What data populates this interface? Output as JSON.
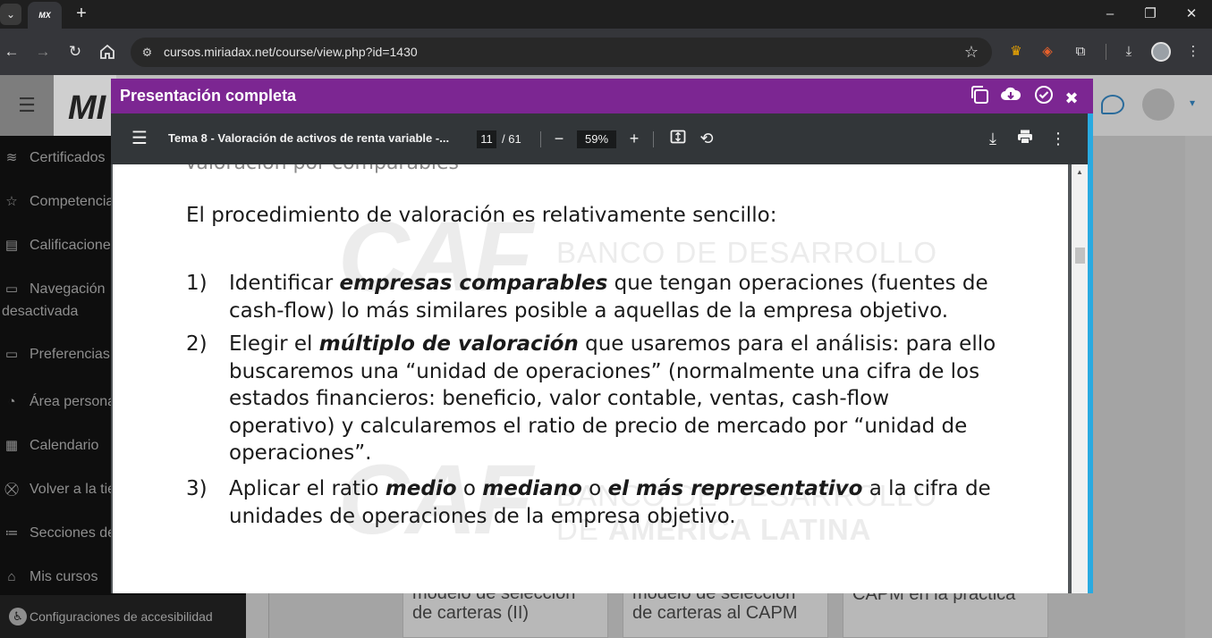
{
  "browser": {
    "tab_favicon_text": "MX",
    "url": "cursos.miriadax.net/course/view.php?id=1430",
    "window_controls": [
      "minimize",
      "restore",
      "close"
    ]
  },
  "site": {
    "brand": "MI"
  },
  "sidebar": {
    "items": [
      {
        "label": "Certificados",
        "icon": "layers-icon"
      },
      {
        "label": "Competencias",
        "icon": "star-icon"
      },
      {
        "label": "Calificaciones",
        "icon": "book-icon"
      },
      {
        "label": "Navegación",
        "label2": "desactivada",
        "icon": "folder-icon"
      },
      {
        "label": "Preferencias",
        "icon": "folder-icon"
      },
      {
        "label": "Área personal",
        "icon": "gauge-icon"
      },
      {
        "label": "Calendario",
        "icon": "calendar-icon"
      },
      {
        "label": "Volver a la tienda",
        "icon": "cart-icon"
      },
      {
        "label": "Secciones del curso",
        "icon": "list-icon"
      },
      {
        "label": "Mis cursos",
        "icon": "graduation-icon"
      }
    ],
    "footer": "Configuraciones de accesibilidad"
  },
  "cards": [
    {
      "line1": "modelo de selección",
      "line2": "de carteras (II)"
    },
    {
      "line1": "modelo de selección",
      "line2": "de carteras al CAPM"
    },
    {
      "line1": "CAPM en la práctica",
      "line2": ""
    }
  ],
  "modal": {
    "title": "Presentación completa"
  },
  "pdf_viewer": {
    "document_title": "Tema 8 - Valoración de activos de renta variable -...",
    "current_page": "11",
    "total_pages": "/ 61",
    "zoom": "59%"
  },
  "slide": {
    "heading_partial": "Valoración por comparables",
    "intro": "El procedimiento de valoración es relativamente sencillo:",
    "watermark": {
      "logo": "CAF",
      "line1": "BANCO DE DESARROLLO",
      "line2a": "DE ",
      "line2b": "AMÉRICA LATINA"
    },
    "items": [
      {
        "num": "1)",
        "pre": "Identificar ",
        "emph": "empresas comparables",
        "post": " que tengan operaciones (fuentes de",
        "lines": [
          "cash-flow) lo más similares posible a aquellas de la empresa objetivo."
        ]
      },
      {
        "num": "2)",
        "pre": "Elegir el ",
        "emph": "múltiplo de valoración",
        "post": " que usaremos para el análisis: para ello",
        "lines": [
          "buscaremos una “unidad de operaciones” (normalmente una cifra de los",
          "estados financieros: beneficio, valor contable, ventas, cash-flow",
          "operativo) y calcularemos el ratio de precio de mercado por “unidad de",
          "operaciones”."
        ]
      },
      {
        "num": "3)",
        "pre": "Aplicar el ratio ",
        "emph": "medio",
        "mid1": " o ",
        "emph2": "mediano",
        "mid2": " o ",
        "emph3": "el más representativo",
        "post": " a la cifra de",
        "lines": [
          "unidades de operaciones de la empresa objetivo."
        ]
      }
    ]
  }
}
